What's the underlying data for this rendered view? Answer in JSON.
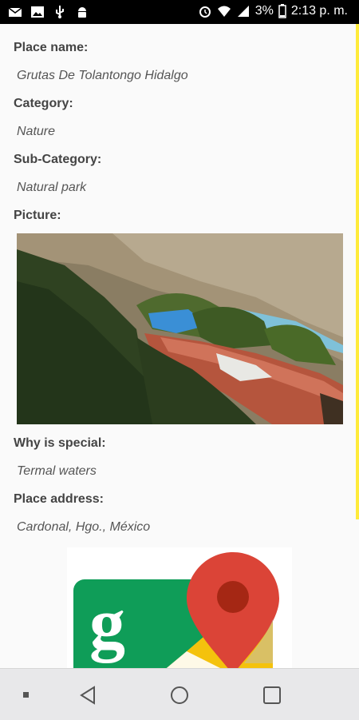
{
  "status_bar": {
    "battery_percent": "3%",
    "time": "2:13 p. m.",
    "left_icons": [
      "mail-icon",
      "image-icon",
      "usb-icon",
      "android-icon"
    ],
    "right_icons": [
      "alarm-icon",
      "wifi-icon",
      "signal-icon",
      "battery-icon"
    ]
  },
  "details": {
    "place_name_label": "Place name:",
    "place_name_value": "Grutas De Tolantongo Hidalgo",
    "category_label": "Category:",
    "category_value": "Nature",
    "subcategory_label": "Sub-Category:",
    "subcategory_value": "Natural park",
    "picture_label": "Picture:",
    "why_special_label": "Why is special:",
    "why_special_value": "Termal waters",
    "address_label": "Place address:",
    "address_value": "Cardonal, Hgo., México"
  },
  "map_icon": {
    "name": "google-maps-icon",
    "glyph": "g"
  },
  "colors": {
    "scrollbar": "#ffeb3b",
    "status_bar_bg": "#000000",
    "nav_bar_bg": "#e8e8ea",
    "maps_green": "#0f9d58",
    "maps_red": "#db4437",
    "maps_yellow": "#f4c20d",
    "maps_blue": "#4285f4"
  },
  "nav_bar": {
    "buttons": [
      "recents-dot-icon",
      "back-icon",
      "home-icon",
      "overview-icon"
    ]
  }
}
